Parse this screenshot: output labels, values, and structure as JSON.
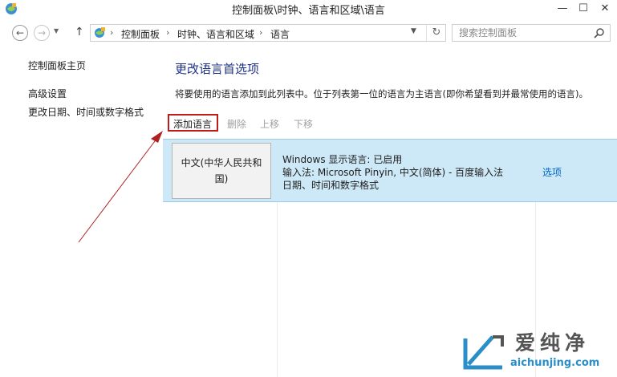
{
  "window": {
    "title": "控制面板\\时钟、语言和区域\\语言",
    "buttons": {
      "minimize": "—",
      "maximize": "☐",
      "close": "✕"
    }
  },
  "navigation": {
    "back_icon": "back-arrow-icon",
    "forward_icon": "forward-arrow-icon",
    "recent_icon": "chevron-down-icon",
    "up_icon": "up-arrow-icon",
    "breadcrumbs": [
      "控制面板",
      "时钟、语言和区域",
      "语言"
    ],
    "search_placeholder": "搜索控制面板"
  },
  "sidebar": {
    "items": [
      "控制面板主页",
      "高级设置",
      "更改日期、时间或数字格式"
    ]
  },
  "main": {
    "title": "更改语言首选项",
    "description": "将要使用的语言添加到此列表中。位于列表第一位的语言为主语言(即你希望看到并最常使用的语言)。",
    "toolbar": {
      "add": "添加语言",
      "remove": "删除",
      "move_up": "上移",
      "move_down": "下移"
    },
    "languages": [
      {
        "name": "中文(中华人民共和国)",
        "display_language": "Windows 显示语言: 已启用",
        "input_method": "输入法: Microsoft Pinyin, 中文(简体) - 百度输入法",
        "format": "日期、时间和数字格式",
        "options": "选项"
      }
    ]
  },
  "watermark": {
    "text": "爱纯净",
    "url": "aichunjing.com"
  },
  "colors": {
    "accent_title": "#1e3287",
    "link": "#0066cc",
    "selection": "#cde8f6",
    "highlight_box": "#c01a1a"
  }
}
